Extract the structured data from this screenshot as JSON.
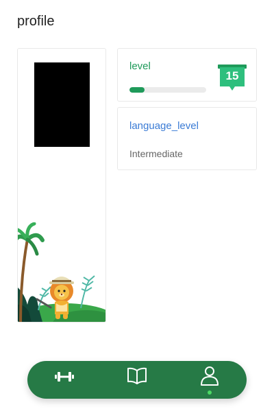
{
  "page": {
    "title": "profile"
  },
  "level": {
    "label": "level",
    "value": "15",
    "progress": 0.2,
    "accent_color": "#1f9a5a",
    "badge_color": "#2ebf7d",
    "badge_ribbon_color": "#1f9a5a"
  },
  "language": {
    "title": "language_level",
    "value": "Intermediate",
    "title_color": "#3a7bd5"
  },
  "nav": {
    "background_color": "#267a46",
    "active_dot_color": "#4cd964",
    "items": [
      {
        "icon": "dumbbell-icon",
        "active": false
      },
      {
        "icon": "book-icon",
        "active": false
      },
      {
        "icon": "user-icon",
        "active": true
      }
    ]
  }
}
